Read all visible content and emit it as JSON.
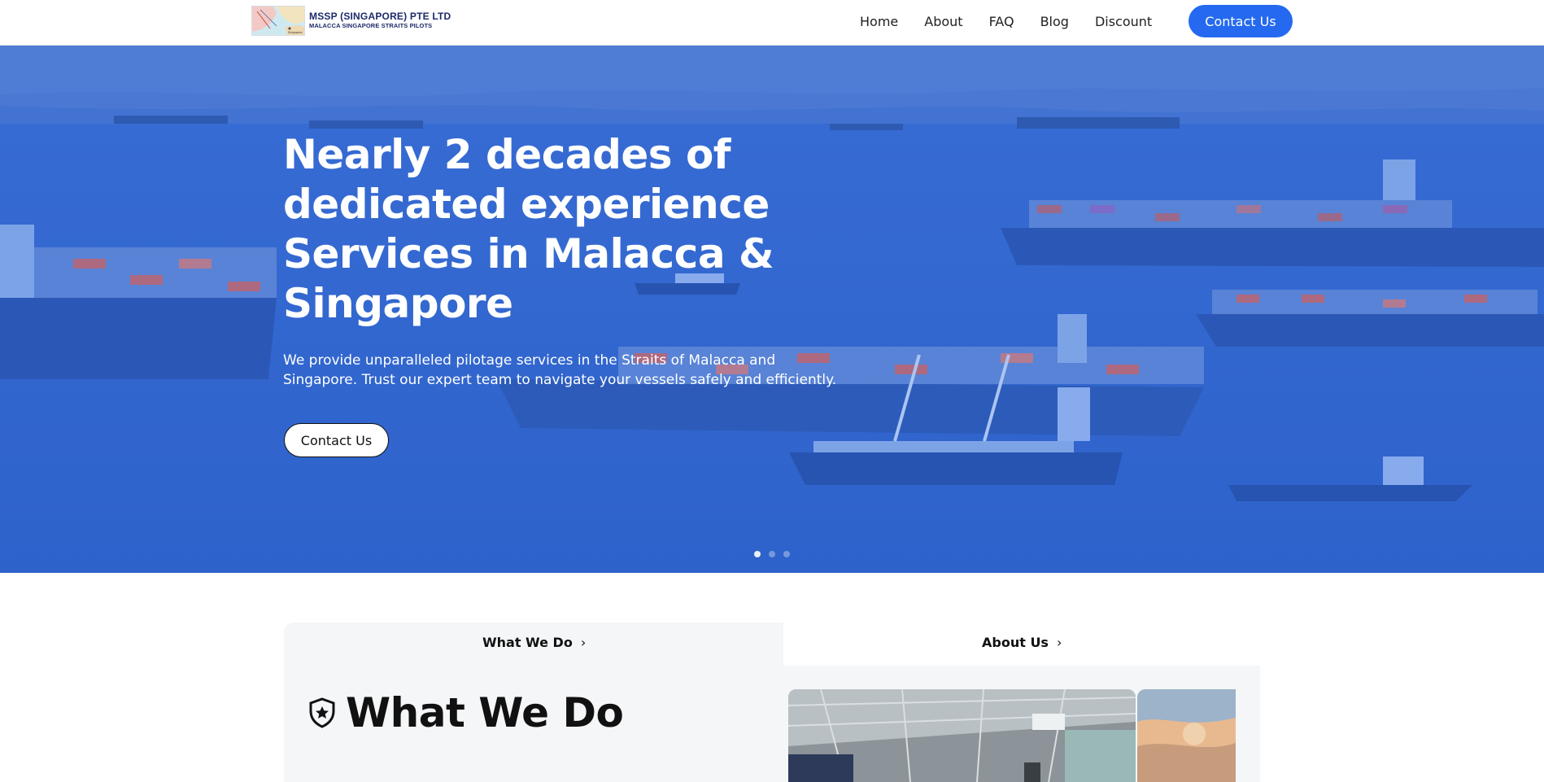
{
  "brand": {
    "company": "MSSP (SINGAPORE) PTE LTD",
    "tagline": "MALACCA SINGAPORE STRAITS PILOTS",
    "map_label": "Singapore"
  },
  "nav": {
    "items": [
      "Home",
      "About",
      "FAQ",
      "Blog",
      "Discount"
    ],
    "cta": "Contact Us"
  },
  "hero": {
    "title_lines": [
      "Nearly 2 decades of",
      "dedicated experience",
      "Services in Malacca &",
      "Singapore"
    ],
    "subtitle_lines": [
      "We provide unparalleled pilotage services in the Straits of Malacca and",
      "Singapore. Trust our expert team to navigate your vessels safely and efficiently."
    ],
    "button": "Contact Us",
    "slides": 3,
    "active_slide": 1
  },
  "tabs": {
    "left": "What We Do",
    "right": "About Us",
    "chevron": "chevron-right-icon"
  },
  "section": {
    "heading": "What We Do",
    "icon": "shield-star-icon"
  },
  "colors": {
    "accent": "#2469ef",
    "hero_overlay": "#3d71d4",
    "panel": "#f4f6f8",
    "brand_text": "#1c2a6b"
  }
}
